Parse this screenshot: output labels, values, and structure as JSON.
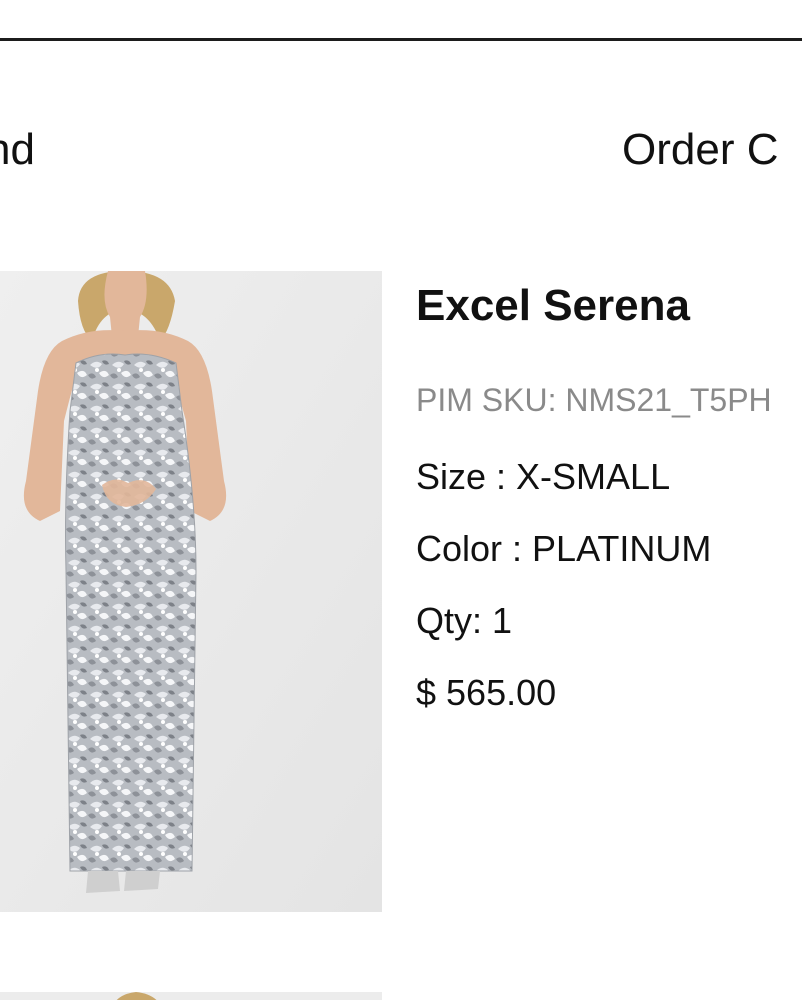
{
  "header": {
    "left_column_label_fragment": "nd",
    "right_column_label_fragment": "Order C"
  },
  "product": {
    "name": "Excel Serena",
    "sku_label": "PIM SKU: NMS21_T5PH",
    "size_line": "Size : X-SMALL",
    "color_line": "Color : PLATINUM",
    "qty_line": "Qty: 1",
    "price_line": "$ 565.00",
    "image_alt": "silver sequin strapless gown"
  },
  "colors": {
    "rule": "#1c1c1c",
    "image_bg": "#ececec",
    "sku_text": "#8a8a8a",
    "text": "#111111"
  }
}
